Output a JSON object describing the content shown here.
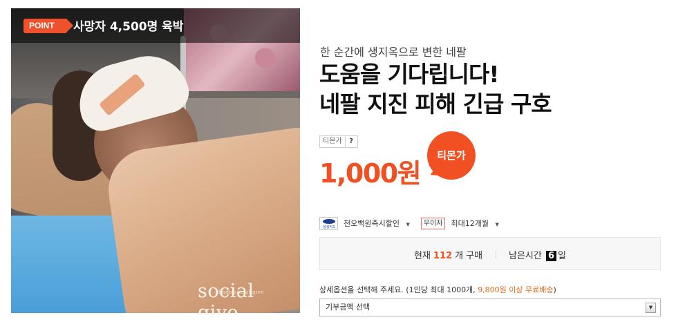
{
  "image": {
    "point_badge": "POINT",
    "caption": "사망자 4,500명 육박",
    "brand_small": "tmon social give",
    "brand": "social give"
  },
  "deal": {
    "subtitle": "한 순간에 생지옥으로 변한 네팔",
    "title_line1": "도움을 기다립니다!",
    "title_line2": "네팔 지진 피해 긴급 구호",
    "price_label": "티몬가",
    "price_help": "?",
    "price": "1,000원",
    "bubble": "티몬가"
  },
  "payment": {
    "card_logo_text": "삼성카드",
    "card_discount": "천오백원즉시할인",
    "interest_free_badge": "무이자",
    "installment": "최대12개월",
    "caret": "▼"
  },
  "status": {
    "current_label": "현재",
    "count": "112",
    "count_suffix": "개 구매",
    "remaining_label": "남은시간",
    "days": "6",
    "days_suffix": "일"
  },
  "option": {
    "note_prefix": "상세옵션을 선택해 주세요. (1인당 최대 1000개, ",
    "note_free": "9,800원 이상 무료배송",
    "note_suffix": ")",
    "select_value": "기부금액 선택",
    "select_arrow": "▼"
  },
  "colors": {
    "accent": "#f05022",
    "free_shipping": "#e06b1d"
  }
}
